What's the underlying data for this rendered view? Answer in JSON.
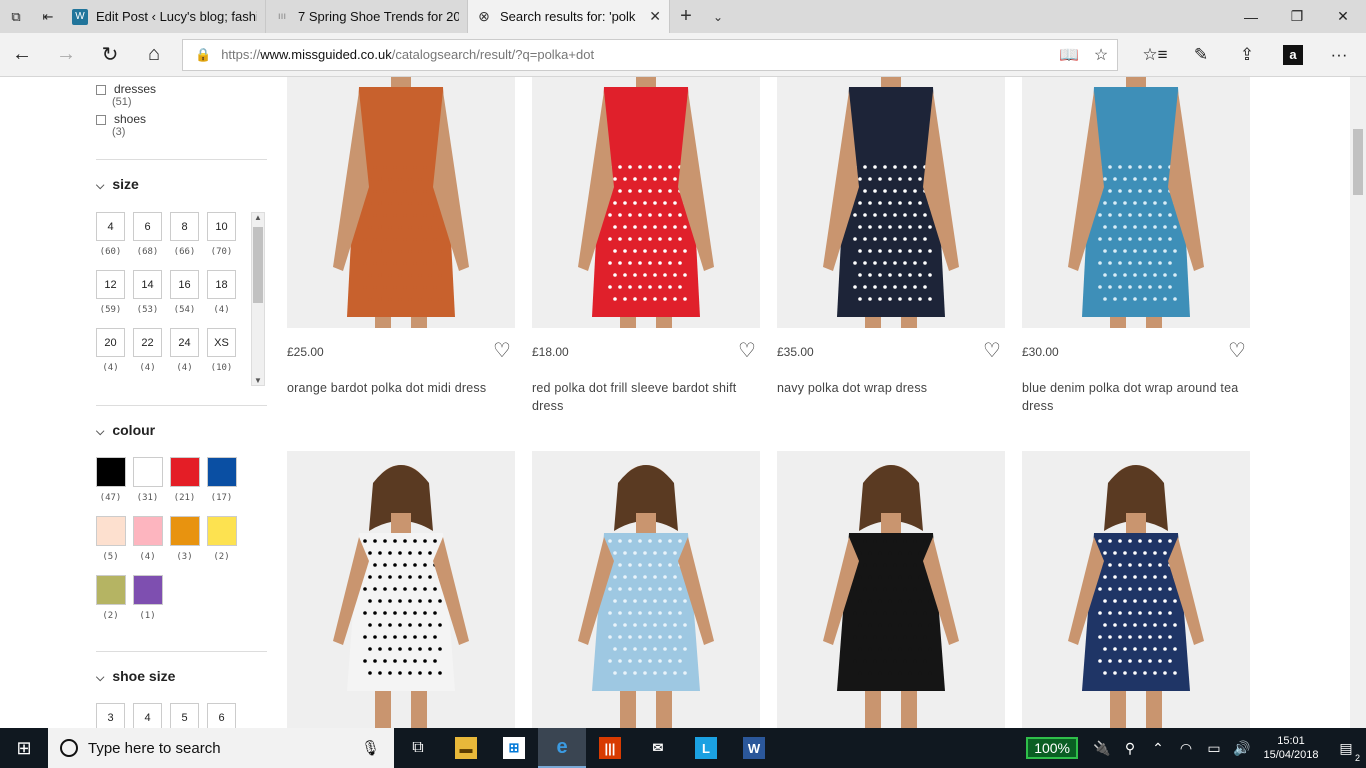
{
  "browser": {
    "tabs": [
      {
        "title": "Edit Post ‹ Lucy's blog; fashi",
        "active": false,
        "favicon_color": "#21759b",
        "favicon_glyph": "W"
      },
      {
        "title": "7 Spring Shoe Trends for 20",
        "active": false,
        "favicon_color": "#999999",
        "favicon_glyph": "ııı"
      },
      {
        "title": "Search results for: 'polk",
        "active": true,
        "favicon_color": "#ffffff",
        "favicon_glyph": "⊗"
      }
    ],
    "url_prefix": "https://",
    "url_domain": "www.missguided.co.uk",
    "url_path": "/catalogsearch/result/?q=polka+dot"
  },
  "sidebar": {
    "categories": [
      {
        "label": "dresses",
        "count": "(51)"
      },
      {
        "label": "shoes",
        "count": "(3)"
      }
    ],
    "size": {
      "title": "size",
      "options": [
        {
          "label": "4",
          "count": "(60)"
        },
        {
          "label": "6",
          "count": "(68)"
        },
        {
          "label": "8",
          "count": "(66)"
        },
        {
          "label": "10",
          "count": "(70)"
        },
        {
          "label": "12",
          "count": "(59)"
        },
        {
          "label": "14",
          "count": "(53)"
        },
        {
          "label": "16",
          "count": "(54)"
        },
        {
          "label": "18",
          "count": "(4)"
        },
        {
          "label": "20",
          "count": "(4)"
        },
        {
          "label": "22",
          "count": "(4)"
        },
        {
          "label": "24",
          "count": "(4)"
        },
        {
          "label": "XS",
          "count": "(10)"
        }
      ]
    },
    "colour": {
      "title": "colour",
      "options": [
        {
          "color": "#000000",
          "count": "(47)"
        },
        {
          "color": "#ffffff",
          "count": "(31)"
        },
        {
          "color": "#e41e26",
          "count": "(21)"
        },
        {
          "color": "#0a4fa3",
          "count": "(17)"
        },
        {
          "color": "#fde0cf",
          "count": "(5)"
        },
        {
          "color": "#fdb5bf",
          "count": "(4)"
        },
        {
          "color": "#e8930f",
          "count": "(3)"
        },
        {
          "color": "#fde250",
          "count": "(2)"
        },
        {
          "color": "#b5b463",
          "count": "(2)"
        },
        {
          "color": "#7e4fb0",
          "count": "(1)"
        }
      ]
    },
    "shoe_size": {
      "title": "shoe size",
      "options": [
        "3",
        "4",
        "5",
        "6"
      ]
    }
  },
  "products": [
    {
      "price": "£25.00",
      "name": "orange bardot polka dot midi dress",
      "color": "#c8612d",
      "dot": "#c8612d"
    },
    {
      "price": "£18.00",
      "name": "red polka dot frill sleeve bardot shift dress",
      "color": "#e0202b",
      "dot": "#ffffff"
    },
    {
      "price": "£35.00",
      "name": "navy polka dot wrap dress",
      "color": "#1d2438",
      "dot": "#ffffff"
    },
    {
      "price": "£30.00",
      "name": "blue denim polka dot wrap around tea dress",
      "color": "#3e8fb8",
      "dot": "#d8ecf6"
    },
    {
      "price": "",
      "name": "",
      "color": "#f4f4f4",
      "dot": "#000000"
    },
    {
      "price": "",
      "name": "",
      "color": "#9ec8e2",
      "dot": "#e8f3fa"
    },
    {
      "price": "",
      "name": "",
      "color": "#151515",
      "dot": "#151515"
    },
    {
      "price": "",
      "name": "",
      "color": "#1f3566",
      "dot": "#ffffff"
    }
  ],
  "taskbar": {
    "search_placeholder": "Type here to search",
    "battery": "100%",
    "time": "15:01",
    "date": "15/04/2018",
    "notifications": "2"
  }
}
